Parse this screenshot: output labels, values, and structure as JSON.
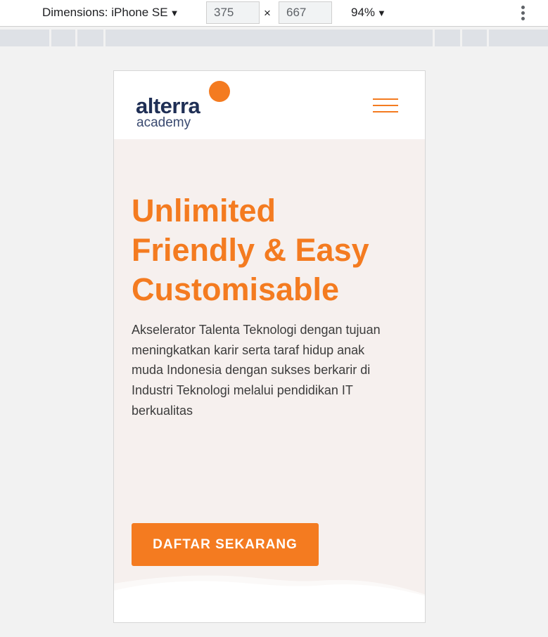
{
  "devtools": {
    "device_label": "Dimensions: iPhone SE",
    "width_value": "375",
    "height_value": "667",
    "times_symbol": "×",
    "zoom_label": "94%",
    "caret_icon": "▼"
  },
  "site": {
    "logo": {
      "main": "alterra",
      "sub": "academy"
    },
    "hero": {
      "title_lines": [
        "Unlimited",
        "Friendly & Easy",
        "Customisable"
      ],
      "description_lines": [
        "Akselerator Talenta Teknologi dengan tujuan",
        "meningkatkan karir serta taraf hidup anak",
        "muda Indonesia dengan sukses berkarir di",
        "Industri Teknologi melalui pendidikan IT",
        "berkualitas"
      ],
      "cta_label": "DAFTAR SEKARANG"
    }
  },
  "colors": {
    "accent": "#f47b20",
    "navy": "#1f2f55",
    "hero_bg": "#f6f0ee"
  },
  "icons": {
    "menu": "hamburger-menu-icon",
    "more": "more-vertical-icon",
    "dropdown": "caret-down-icon"
  }
}
